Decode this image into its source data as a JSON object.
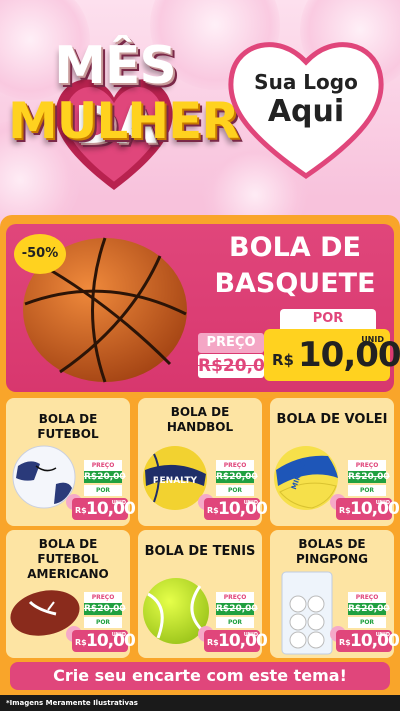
{
  "header": {
    "title_line1": "MÊS DA",
    "title_line2": "MULHER",
    "logo_line1": "Sua Logo",
    "logo_line2": "Aqui"
  },
  "featured": {
    "discount": "-50%",
    "title_line1": "BOLA DE",
    "title_line2": "BASQUETE",
    "por_label": "POR",
    "preco_label": "PREÇO",
    "old_price": "R$20,00",
    "currency": "R$",
    "new_price": "10,00",
    "unit": "UNID"
  },
  "products": [
    {
      "title": "BOLA DE FUTEBOL",
      "preco_label": "PREÇO",
      "old_price": "R$20,00",
      "por_label": "POR",
      "currency": "R$",
      "new_price": "10,00",
      "unit": "UNID"
    },
    {
      "title": "BOLA DE HANDBOL",
      "preco_label": "PREÇO",
      "old_price": "R$20,00",
      "por_label": "POR",
      "currency": "R$",
      "new_price": "10,00",
      "unit": "UNID",
      "ball_text": "PENALTY"
    },
    {
      "title": "BOLA DE VOLEI",
      "preco_label": "PREÇO",
      "old_price": "R$20,00",
      "por_label": "POR",
      "currency": "R$",
      "new_price": "10,00",
      "unit": "UNID",
      "ball_text": "MIKASA"
    },
    {
      "title": "BOLA DE FUTEBOL AMERICANO",
      "preco_label": "PREÇO",
      "old_price": "R$20,00",
      "por_label": "POR",
      "currency": "R$",
      "new_price": "10,00",
      "unit": "UNID"
    },
    {
      "title": "BOLA DE TENIS",
      "preco_label": "PREÇO",
      "old_price": "R$20,00",
      "por_label": "POR",
      "currency": "R$",
      "new_price": "10,00",
      "unit": "UNID"
    },
    {
      "title": "BOLAS DE PINGPONG",
      "preco_label": "PREÇO",
      "old_price": "R$20,00",
      "por_label": "POR",
      "currency": "R$",
      "new_price": "10,00",
      "unit": "UNID"
    }
  ],
  "cta": "Crie seu encarte com este tema!",
  "footnote": "*Imagens Meramente Ilustrativas",
  "colors": {
    "pink": "#e0467b",
    "yellow": "#ffd21f",
    "orange": "#f9a52a",
    "card": "#fde4a3",
    "green": "#20a040"
  },
  "icons": [
    "basketball-icon",
    "soccer-ball-icon",
    "handball-icon",
    "volleyball-icon",
    "american-football-icon",
    "tennis-ball-icon",
    "pingpong-balls-icon",
    "heart-icon"
  ]
}
